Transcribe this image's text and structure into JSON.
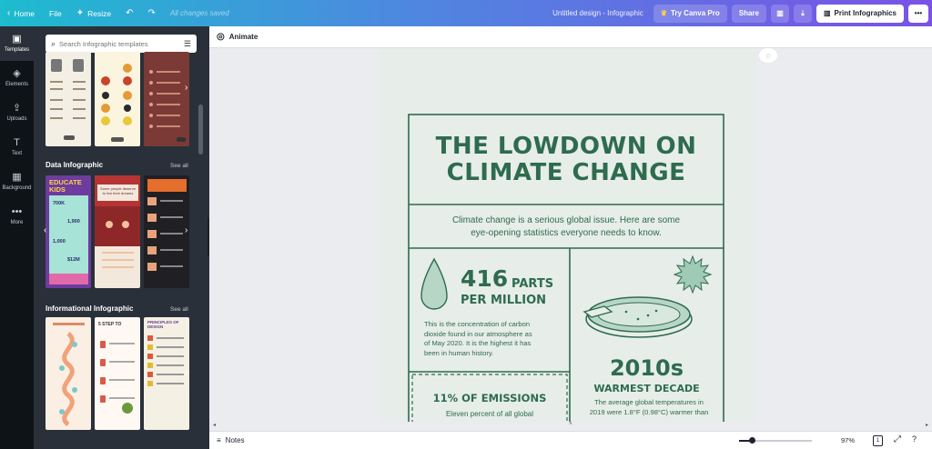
{
  "topbar": {
    "home": "Home",
    "file": "File",
    "resize": "Resize",
    "status": "All changes saved",
    "design_title": "Untitled design - Infographic",
    "try_pro": "Try Canva Pro",
    "share": "Share",
    "print": "Print Infographics",
    "more": "•••"
  },
  "rail": [
    {
      "label": "Templates",
      "glyph": "▣"
    },
    {
      "label": "Elements",
      "glyph": "◈"
    },
    {
      "label": "Uploads",
      "glyph": "⇪"
    },
    {
      "label": "Text",
      "glyph": "T"
    },
    {
      "label": "Background",
      "glyph": "▦"
    },
    {
      "label": "More",
      "glyph": "•••"
    }
  ],
  "search": {
    "placeholder": "Search Infographic templates"
  },
  "sections": [
    {
      "title": "Data Infographic",
      "see_all": "See all"
    },
    {
      "title": "Informational Infographic",
      "see_all": "See all"
    }
  ],
  "thumbs": {
    "educate_kids": "EDUCATE KIDS",
    "stat1": "700K",
    "stat2": "1,900",
    "stat3": "1,000",
    "stat4": "$12M",
    "know_people": "Some people deserve to live their dreams",
    "step_to": "5 STEP TO",
    "principles": "PRINCIPLES OF DESIGN"
  },
  "editor": {
    "animate": "Animate",
    "notes": "Notes",
    "zoom": "97%",
    "page_num": "1"
  },
  "infographic": {
    "title_line1": "THE LOWDOWN ON",
    "title_line2": "CLIMATE CHANGE",
    "intro_line1": "Climate change is a serious global issue. Here are some",
    "intro_line2": "eye-opening statistics everyone needs to know.",
    "stat1_number": "416",
    "stat1_unit": "PARTS",
    "stat1_unit2": "PER MILLION",
    "stat1_desc": [
      "This is the concentration of carbon",
      "dioxide  found in our atmosphere as",
      "of May 2020. It is the highest it has",
      "been in human history."
    ],
    "stat2_number": "2010s",
    "stat2_label": "WARMEST DECADE",
    "stat2_desc": [
      "The average global temperatures in",
      "2019 were 1.8°F (0.98°C) warmer than"
    ],
    "stat3_title": "11% OF EMISSIONS",
    "stat3_desc": "Eleven percent of all global"
  }
}
